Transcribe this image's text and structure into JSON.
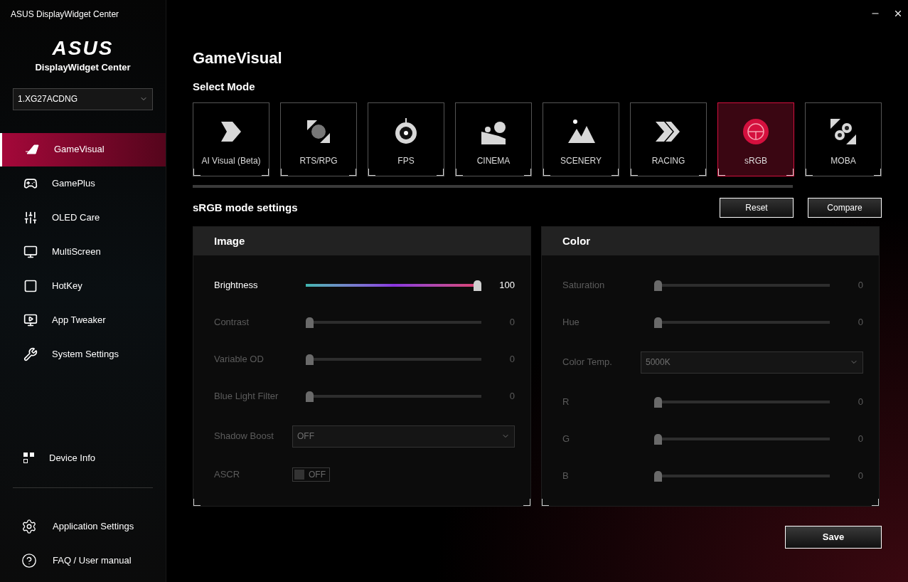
{
  "window": {
    "title": "ASUS DisplayWidget Center"
  },
  "sidebar": {
    "logo": "ASUS",
    "subtitle": "DisplayWidget Center",
    "device": "1.XG27ACDNG",
    "items": [
      {
        "label": "GameVisual",
        "selected": true
      },
      {
        "label": "GamePlus",
        "selected": false
      },
      {
        "label": "OLED Care",
        "selected": false
      },
      {
        "label": "MultiScreen",
        "selected": false
      },
      {
        "label": "HotKey",
        "selected": false
      },
      {
        "label": "App Tweaker",
        "selected": false
      },
      {
        "label": "System Settings",
        "selected": false
      }
    ],
    "device_info": "Device Info",
    "footer": [
      {
        "label": "Application Settings"
      },
      {
        "label": "FAQ / User manual"
      }
    ]
  },
  "page": {
    "title": "GameVisual",
    "select_mode": "Select Mode",
    "modes": [
      {
        "label": "AI Visual (Beta)",
        "selected": false
      },
      {
        "label": "RTS/RPG",
        "selected": false
      },
      {
        "label": "FPS",
        "selected": false
      },
      {
        "label": "CINEMA",
        "selected": false
      },
      {
        "label": "SCENERY",
        "selected": false
      },
      {
        "label": "RACING",
        "selected": false
      },
      {
        "label": "sRGB",
        "selected": true
      },
      {
        "label": "MOBA",
        "selected": false
      }
    ],
    "settings_title": "sRGB mode settings",
    "buttons": [
      "Reset",
      "Compare"
    ],
    "panels": [
      {
        "title": "Image",
        "rows": [
          {
            "kind": "slider",
            "label": "Brightness",
            "level": 1,
            "reading": "100",
            "disabled": false
          },
          {
            "kind": "slider",
            "label": "Contrast",
            "level": 0,
            "reading": "0",
            "disabled": true
          },
          {
            "kind": "slider",
            "label": "Variable OD",
            "level": 0,
            "reading": "0",
            "disabled": true
          },
          {
            "kind": "slider",
            "label": "Blue Light Filter",
            "level": 0,
            "reading": "0",
            "disabled": true
          },
          {
            "kind": "dropdown",
            "label": "Shadow Boost",
            "value": "OFF",
            "disabled": true
          },
          {
            "kind": "toggle",
            "label": "ASCR",
            "value": "OFF",
            "on": false,
            "disabled": true
          }
        ]
      },
      {
        "title": "Color",
        "rows": [
          {
            "kind": "slider",
            "label": "Saturation",
            "level": 0,
            "reading": "0",
            "disabled": true
          },
          {
            "kind": "slider",
            "label": "Hue",
            "level": 0,
            "reading": "0",
            "disabled": true
          },
          {
            "kind": "dropdown",
            "label": "Color Temp.",
            "value": "5000K",
            "disabled": true
          },
          {
            "kind": "slider",
            "label": "R",
            "level": 0,
            "reading": "0",
            "disabled": true
          },
          {
            "kind": "slider",
            "label": "G",
            "level": 0,
            "reading": "0",
            "disabled": true
          },
          {
            "kind": "slider",
            "label": "B",
            "level": 0,
            "reading": "0",
            "disabled": true
          }
        ]
      }
    ],
    "save": "Save"
  }
}
